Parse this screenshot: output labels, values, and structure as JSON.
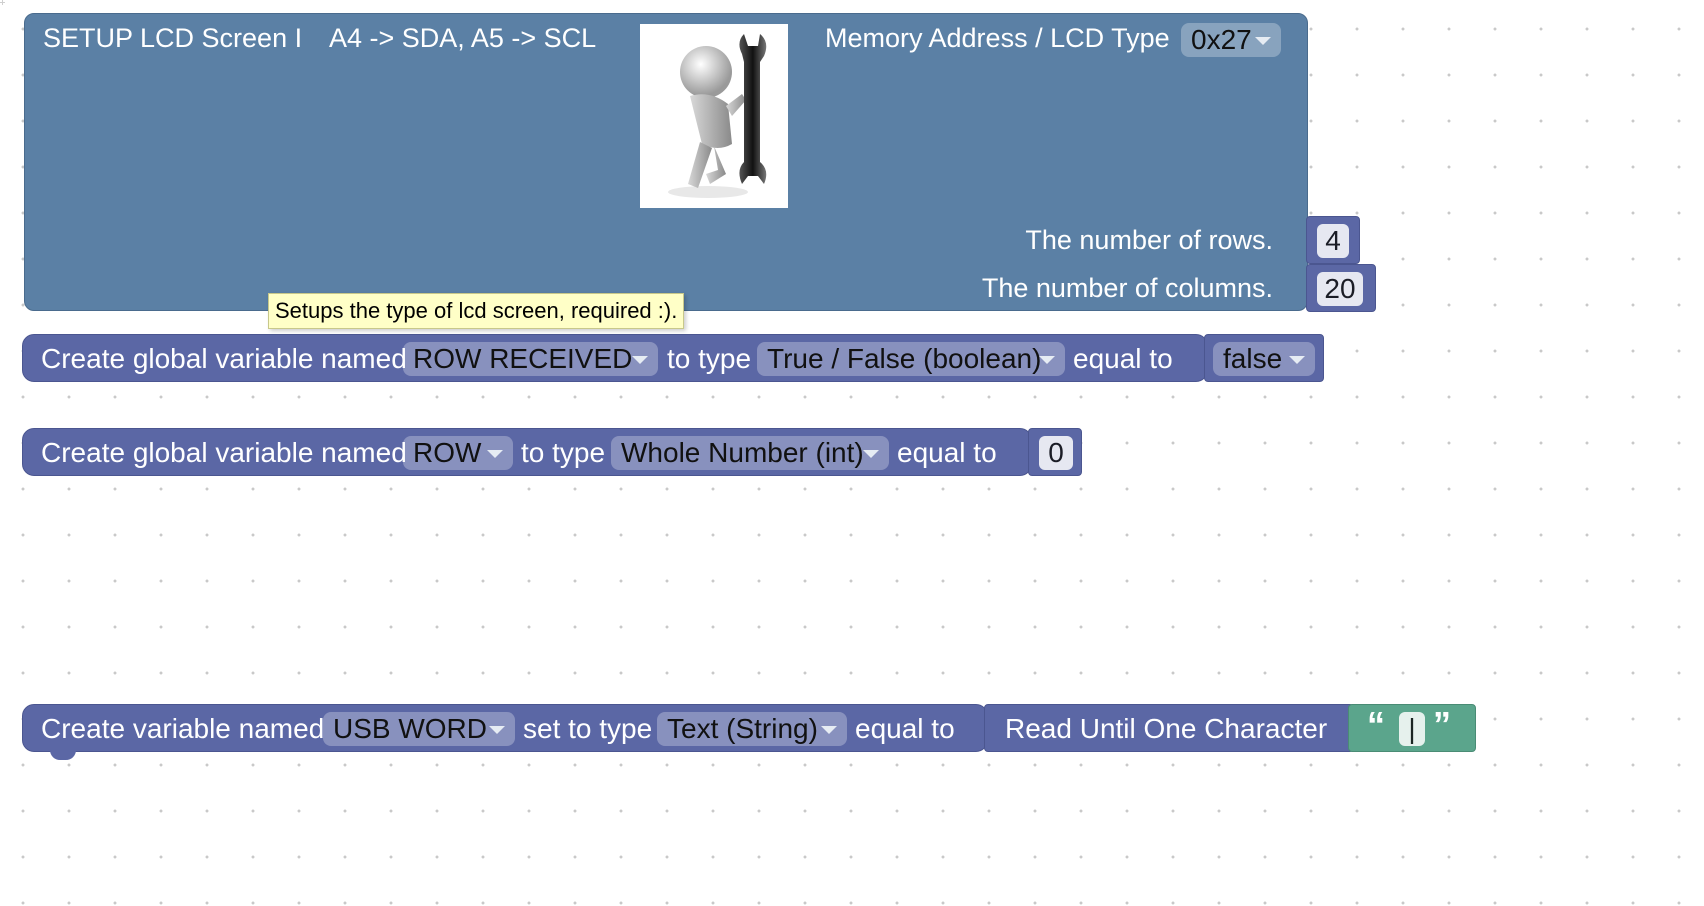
{
  "setup_block": {
    "title": "SETUP LCD Screen I",
    "wiring": "A4 -> SDA, A5 -> SCL",
    "image_icon": "figure-with-wrench-icon",
    "memory_label": "Memory Address / LCD Type",
    "memory_value": "0x27",
    "rows_label": "The number of rows.",
    "rows_value": "4",
    "columns_label": "The number of columns.",
    "columns_value": "20",
    "tooltip": "Setups the type of lcd screen, required :)."
  },
  "global_var_1": {
    "prefix": "Create global variable named",
    "name": "ROW RECEIVED",
    "type_label": "to type",
    "type": "True / False (boolean)",
    "equal_label": "equal to",
    "value": "false"
  },
  "global_var_2": {
    "prefix": "Create global variable named",
    "name": "ROW",
    "type_label": "to type",
    "type": "Whole Number (int)",
    "equal_label": "equal to",
    "value": "0"
  },
  "local_var": {
    "prefix": "Create variable named",
    "name": "USB WORD",
    "type_label": "set to type",
    "type": "Text (String)",
    "equal_label": "equal to",
    "read_label": "Read Until One Character",
    "open_quote": "“",
    "char_value": "|",
    "close_quote": "”"
  },
  "colors": {
    "setup_block": "#5b80a5",
    "variable_block": "#5b67a5",
    "text_block": "#5ba58c",
    "tooltip_bg": "#ffffc7"
  }
}
